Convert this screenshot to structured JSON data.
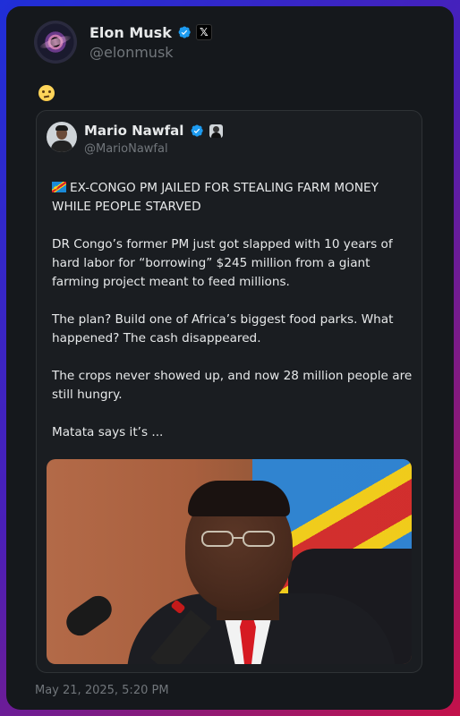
{
  "post": {
    "author_name": "Elon Musk",
    "author_handle": "@elonmusk",
    "verified_badge": "verified-icon",
    "affiliate_badge": "x-logo-icon",
    "emoji": "face-with-raised-eyebrow",
    "timestamp": "May 21, 2025, 5:20 PM"
  },
  "quote": {
    "author_name": "Mario Nawfal",
    "author_handle": "@MarioNawfal",
    "verified_badge": "verified-icon",
    "affiliate_badge": "profile-badge-icon",
    "headline_flag": "dr-congo-flag",
    "headline": "EX-CONGO PM JAILED FOR STEALING FARM MONEY WHILE PEOPLE STARVED",
    "paragraph1": "DR Congo’s former PM just got slapped with 10 years of hard labor for “borrowing” $245 million from a giant farming project meant to feed millions.",
    "paragraph2": "The plan? Build one of Africa’s biggest food parks. What happened? The cash disappeared.",
    "paragraph3": "The crops never showed up, and now 28 million people are still hungry.",
    "paragraph4": "Matata says it’s ...",
    "media": "photo-of-man-speaking-at-microphone"
  },
  "colors": {
    "background": "#15181c",
    "text": "#e7e9ea",
    "muted": "#71767b",
    "verified_blue": "#1d9bf0",
    "border": "#2f3336"
  }
}
